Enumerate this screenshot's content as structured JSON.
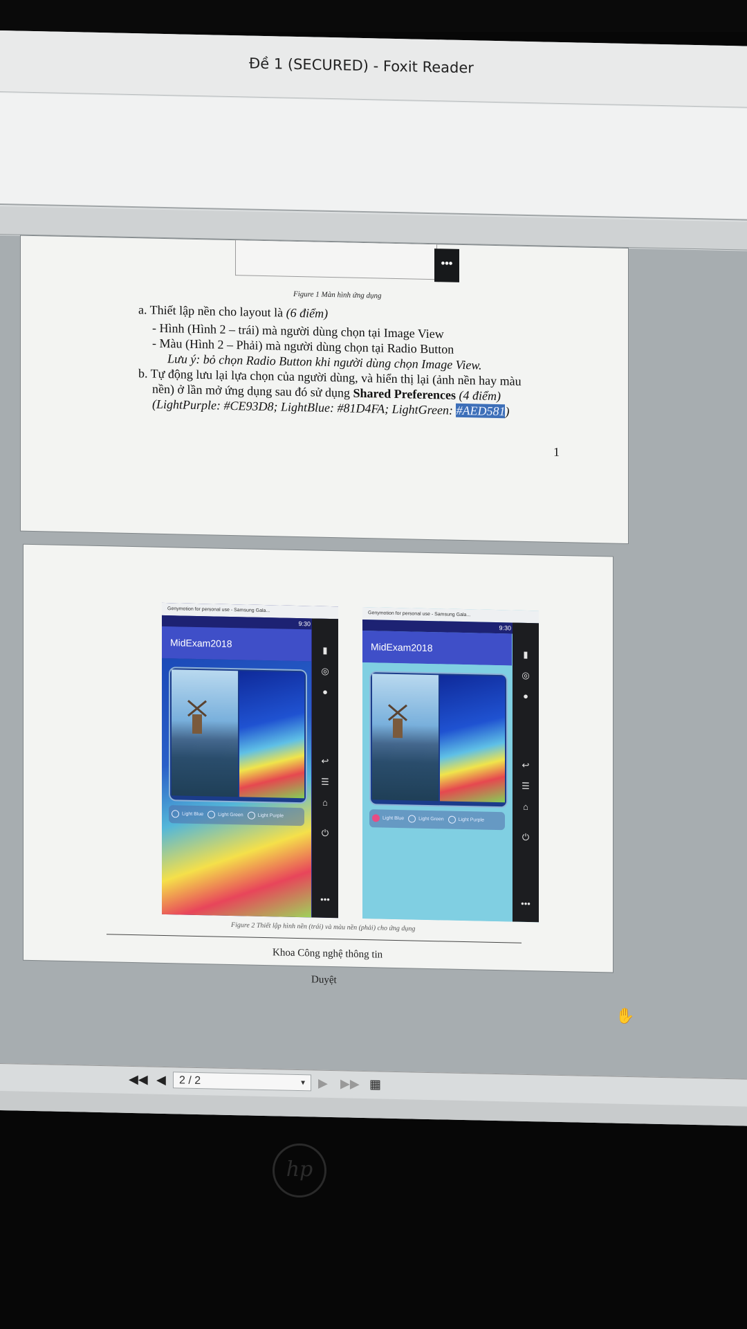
{
  "window": {
    "title": "Đề 1  (SECURED) - Foxit Reader"
  },
  "page1": {
    "figure1_caption": "Figure 1 Màn hình ứng dụng",
    "item_a": "a.  Thiết lập nền cho layout là",
    "item_a_points": "(6 điểm)",
    "bullet1": "-    Hình (Hình 2 – trái) mà người dùng chọn tại Image View",
    "bullet2": "-    Màu (Hình 2 – Phải) mà người dùng chọn tại Radio Button",
    "note": "Lưu ý: bỏ chọn Radio Button khi người dùng chọn Image View.",
    "item_b_line1": "b.  Tự động lưu lại lựa chọn của người dùng, và hiển thị lại (ảnh nền hay màu",
    "item_b_line2_start": "nền) ở lần mở ứng dụng sau đó sử dụng",
    "item_b_bold": "Shared Preferences",
    "item_b_points": "(4 điểm)",
    "colors_prefix": "(LightPurple: #CE93D8; LightBlue: #81D4FA; LightGreen:",
    "colors_highlight": "#AED581",
    "colors_suffix": ")",
    "page_number": "1",
    "more_button": "•••"
  },
  "page2": {
    "emulator_left": {
      "window_title": "Genymotion for personal use - Samsung Gala...",
      "time": "9:30",
      "app_title": "MidExam2018",
      "radio_labels": [
        "Light Blue",
        "Light Green",
        "Light Purple"
      ],
      "selected": -1
    },
    "emulator_right": {
      "window_title": "Genymotion for personal use - Samsung Gala...",
      "time": "9:30",
      "app_title": "MidExam2018",
      "radio_labels": [
        "Light Blue",
        "Light Green",
        "Light Purple"
      ],
      "selected": 0
    },
    "figure2_caption": "Figure 2 Thiết lập hình nền (trái) và màu nền (phải) cho ứng dụng",
    "footer_dept": "Khoa Công nghệ thông tin",
    "footer_approved": "Duyệt"
  },
  "navigation": {
    "page_indicator": "2 / 2",
    "first_icon": "first-page-icon",
    "prev_icon": "prev-page-icon",
    "next_icon": "next-page-icon",
    "last_icon": "last-page-icon"
  },
  "emulator_side_icons": [
    "battery-icon",
    "gps-icon",
    "camera-icon",
    "back-icon",
    "menu-icon",
    "home-icon",
    "power-icon"
  ],
  "colors": {
    "highlight": "#3d6fb8",
    "selected_radio": "#e84c84",
    "app_bar": "#3f4fc8"
  }
}
